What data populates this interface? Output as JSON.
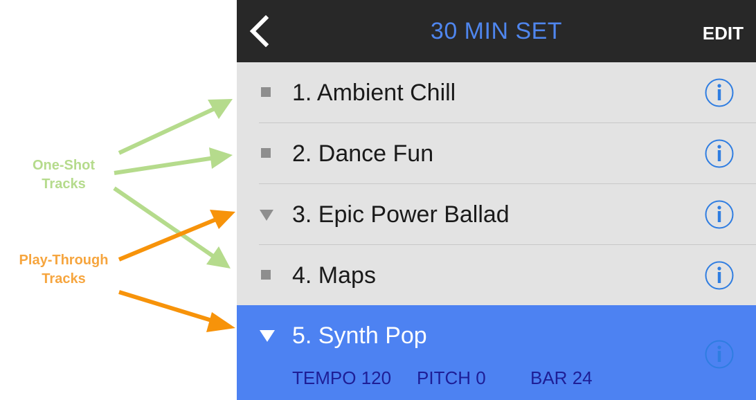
{
  "annotations": {
    "one_shot": {
      "line1": "One-Shot",
      "line2": "Tracks",
      "color": "#b5db8c"
    },
    "play_through": {
      "line1": "Play-Through",
      "line2": "Tracks",
      "color": "#f6a53e"
    }
  },
  "header": {
    "back_icon": "chevron-left-icon",
    "title": "30 MIN SET",
    "edit_label": "EDIT",
    "title_color": "#4f86ee",
    "background": "#282828"
  },
  "tracks": [
    {
      "label": "1. Ambient Chill",
      "type": "one-shot",
      "marker": "square-icon"
    },
    {
      "label": "2. Dance Fun",
      "type": "one-shot",
      "marker": "square-icon"
    },
    {
      "label": "3. Epic Power Ballad",
      "type": "play-through",
      "marker": "triangle-down-icon"
    },
    {
      "label": "4. Maps",
      "type": "one-shot",
      "marker": "square-icon"
    },
    {
      "label": "5. Synth Pop",
      "type": "play-through",
      "marker": "triangle-down-icon",
      "selected": true,
      "params": {
        "tempo_label": "TEMPO",
        "tempo_value": "120",
        "pitch_label": "PITCH",
        "pitch_value": "0",
        "bar_label": "BAR",
        "bar_value": "24"
      }
    }
  ],
  "colors": {
    "selected_row": "#4d82f2",
    "info_icon": "#2f7de1",
    "list_bg": "#e3e3e3"
  }
}
